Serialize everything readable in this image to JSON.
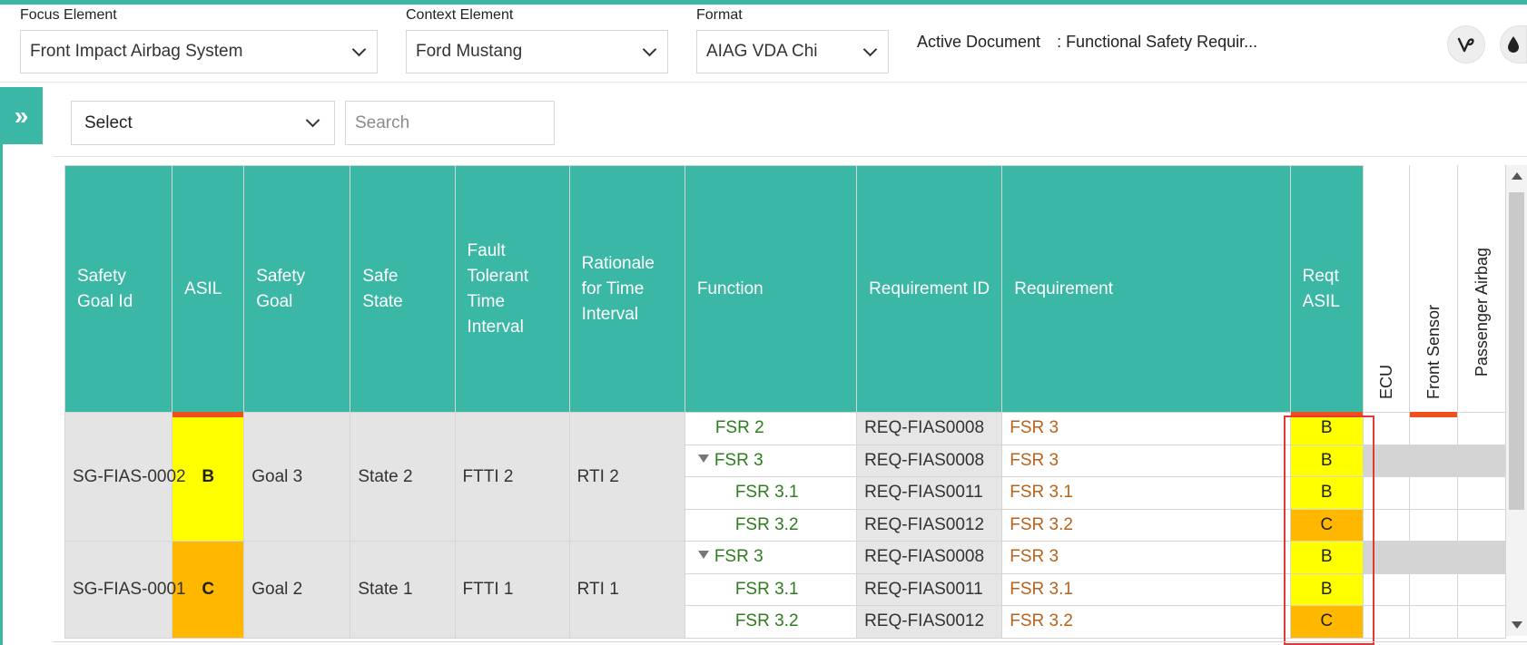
{
  "header": {
    "focus_label": "Focus Element",
    "focus_value": "Front Impact Airbag System",
    "context_label": "Context Element",
    "context_value": "Ford Mustang",
    "format_label": "Format",
    "format_value": "AIAG VDA Chi",
    "active_doc_label": "Active Document",
    "active_doc_value": ": Functional Safety Requir...",
    "icons": [
      "vine-logo-icon",
      "drop-icon"
    ]
  },
  "sidebar": {
    "toggle_icon": "»"
  },
  "toolbar": {
    "select_value": "Select",
    "search_placeholder": "Search"
  },
  "table": {
    "headers": {
      "safety_goal_id": "Safety Goal Id",
      "asil": "ASIL",
      "safety_goal": "Safety Goal",
      "safe_state": "Safe State",
      "ftti": "Fault Tolerant Time Interval",
      "rationale": "Rationale for Time Interval",
      "function": "Function",
      "requirement_id": "Requirement ID",
      "requirement": "Requirement",
      "reqt_asil": "Reqt ASIL",
      "ecu": "ECU",
      "front_sensor": "Front Sensor",
      "passenger_airbag": "Passenger Airbag"
    },
    "groups": [
      {
        "safety_goal_id": "SG-FIAS-0002",
        "asil": "B",
        "safety_goal": "Goal 3",
        "safe_state": "State 2",
        "ftti": "FTTI 2",
        "rationale": "RTI 2",
        "rows": [
          {
            "function": "FSR 2",
            "req_id": "REQ-FIAS0008",
            "requirement": "FSR 3",
            "reqt_asil": "B"
          },
          {
            "function": "FSR 3",
            "req_id": "REQ-FIAS0008",
            "requirement": "FSR 3",
            "reqt_asil": "B"
          },
          {
            "function": "FSR 3.1",
            "req_id": "REQ-FIAS0011",
            "requirement": "FSR 3.1",
            "reqt_asil": "B"
          },
          {
            "function": "FSR 3.2",
            "req_id": "REQ-FIAS0012",
            "requirement": "FSR 3.2",
            "reqt_asil": "C"
          }
        ]
      },
      {
        "safety_goal_id": "SG-FIAS-0001",
        "asil": "C",
        "safety_goal": "Goal 2",
        "safe_state": "State 1",
        "ftti": "FTTI 1",
        "rationale": "RTI 1",
        "rows": [
          {
            "function": "FSR 3",
            "req_id": "REQ-FIAS0008",
            "requirement": "FSR 3",
            "reqt_asil": "B"
          },
          {
            "function": "FSR 3.1",
            "req_id": "REQ-FIAS0011",
            "requirement": "FSR 3.1",
            "reqt_asil": "B"
          },
          {
            "function": "FSR 3.2",
            "req_id": "REQ-FIAS0012",
            "requirement": "FSR 3.2",
            "reqt_asil": "C"
          }
        ]
      }
    ]
  },
  "colors": {
    "accent": "#3bb7a6",
    "asil_b": "#ffff00",
    "asil_c": "#ffb700",
    "function_text": "#2e7d1e",
    "requirement_text": "#b8621a",
    "highlight": "#e53935",
    "header_bar": "#f04e1a"
  }
}
